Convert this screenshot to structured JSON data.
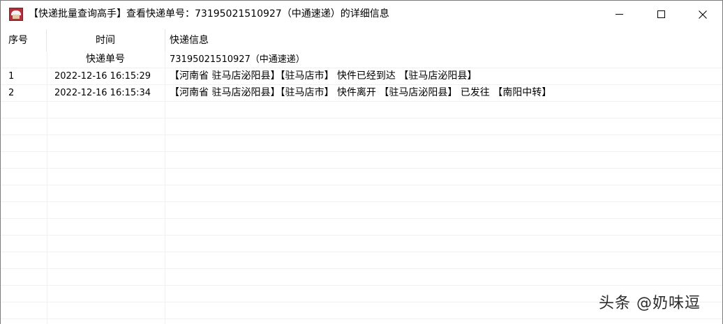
{
  "window": {
    "title": "【快递批量查询高手】查看快递单号：73195021510927（中通速递）的详细信息"
  },
  "table": {
    "columns": [
      "序号",
      "时间",
      "快递信息"
    ],
    "subheader": {
      "time": "快递单号",
      "info": "73195021510927（中通速递）"
    },
    "rows": [
      {
        "no": "1",
        "time": "2022-12-16 16:15:29",
        "info": "【河南省 驻马店泌阳县】【驻马店市】 快件已经到达 【驻马店泌阳县】"
      },
      {
        "no": "2",
        "time": "2022-12-16 16:15:34",
        "info": "【河南省 驻马店泌阳县】【驻马店市】 快件离开 【驻马店泌阳县】 已发往 【南阳中转】"
      }
    ]
  },
  "watermark": "头条 @奶味逗"
}
